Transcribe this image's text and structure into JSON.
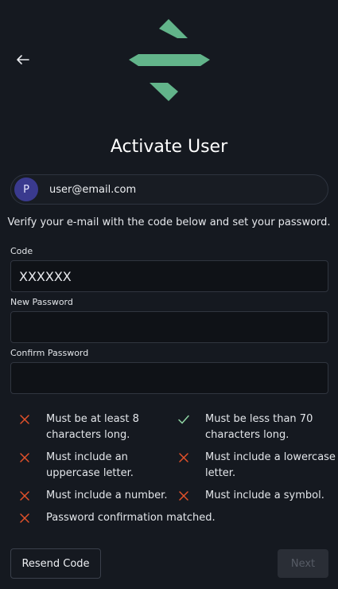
{
  "colors": {
    "background": "#151920",
    "accent": "#62b48a",
    "fail": "#e2512a",
    "pass": "#8fd3a3"
  },
  "header": {
    "back_icon": "arrow-left-icon",
    "logo": "app-logo"
  },
  "title": "Activate User",
  "user": {
    "avatar_initial": "P",
    "email": "user@email.com"
  },
  "description": "Verify your e-mail with the code below and set your password.",
  "form": {
    "code": {
      "label": "Code",
      "placeholder": "XXXXXX",
      "value": ""
    },
    "new_password": {
      "label": "New Password",
      "value": ""
    },
    "confirm_password": {
      "label": "Confirm Password",
      "value": ""
    }
  },
  "requirements": [
    {
      "line1": "Must be at least 8",
      "line2": "characters long.",
      "met": false
    },
    {
      "line1": "Must be less than 70",
      "line2": "characters long.",
      "met": true
    },
    {
      "line1": "Must include an",
      "line2": "uppercase letter.",
      "met": false
    },
    {
      "line1": "Must include a lowercase",
      "line2": "letter.",
      "met": false
    },
    {
      "line1": "Must include a number.",
      "line2": "",
      "met": false
    },
    {
      "line1": "Must include a symbol.",
      "line2": "",
      "met": false
    },
    {
      "line1": "Password confirmation matched.",
      "line2": "",
      "met": false
    }
  ],
  "actions": {
    "resend_label": "Resend Code",
    "next_label": "Next",
    "next_disabled": true
  }
}
